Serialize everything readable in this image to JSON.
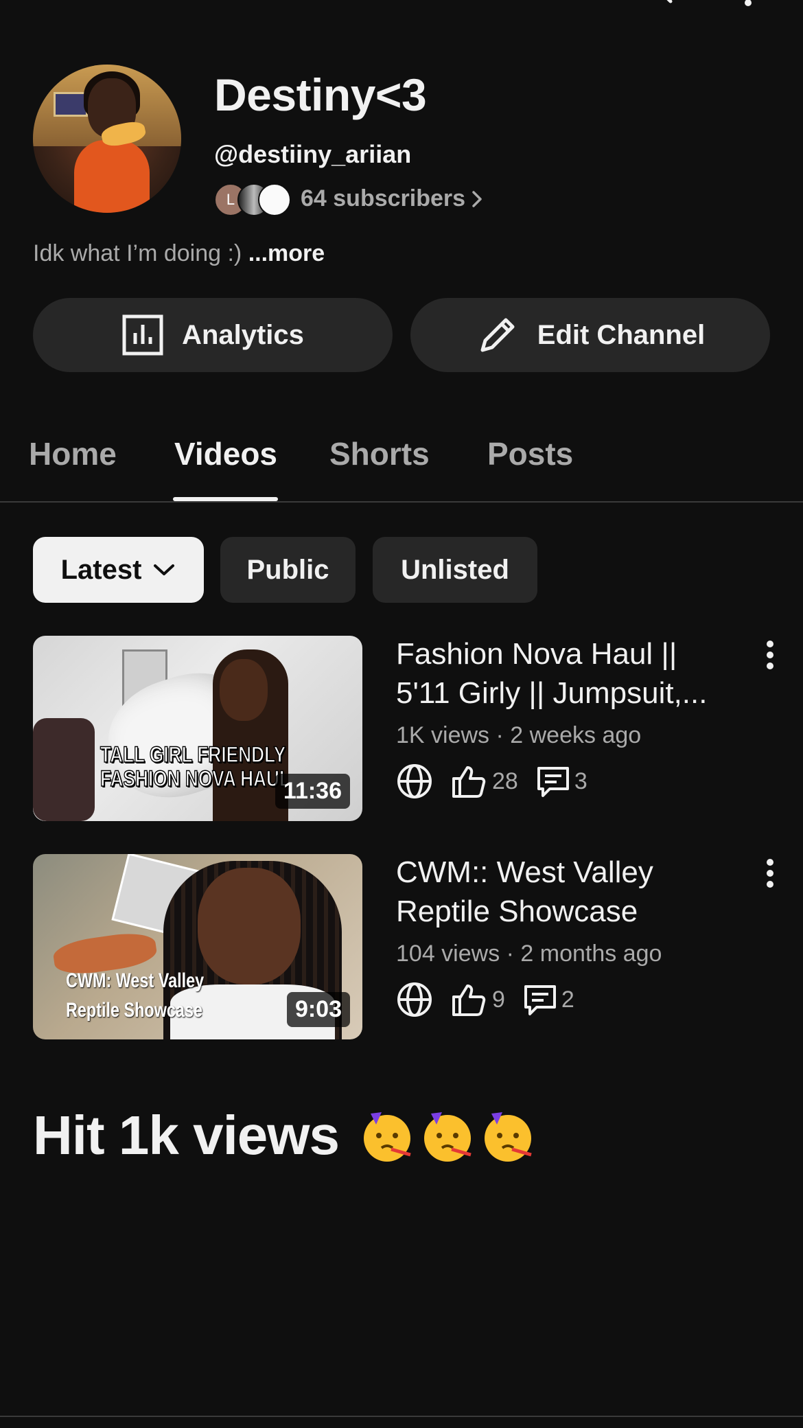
{
  "channel": {
    "name": "Destiny<3",
    "handle": "@destiiny_ariian",
    "subscribers": "64 subscribers",
    "subscriber_avatar_initial": "L",
    "bio": "Idk what I’m doing :)",
    "bio_more": "...more"
  },
  "actions": {
    "analytics_label": "Analytics",
    "edit_label": "Edit Channel"
  },
  "tabs": [
    {
      "label": "Home",
      "active": false
    },
    {
      "label": "Videos",
      "active": true
    },
    {
      "label": "Shorts",
      "active": false
    },
    {
      "label": "Posts",
      "active": false
    }
  ],
  "filters": [
    {
      "label": "Latest",
      "selected": true,
      "dropdown": true
    },
    {
      "label": "Public",
      "selected": false
    },
    {
      "label": "Unlisted",
      "selected": false
    }
  ],
  "videos": [
    {
      "title": "Fashion Nova Haul || 5'11 Girly || Jumpsuit,...",
      "meta": "1K views · 2 weeks ago",
      "duration": "11:36",
      "thumb_caption_line1": "TALL GIRL FRIENDLY",
      "thumb_caption_line2": "FASHION NOVA HAUL",
      "likes": "28",
      "comments": "3",
      "visibility_icon": "globe-icon"
    },
    {
      "title": "CWM:: West Valley Reptile Showcase",
      "meta": "104 views · 2 months ago",
      "duration": "9:03",
      "thumb_caption_line1": "CWM: West Valley",
      "thumb_caption_line2": "Reptile Showcase",
      "likes": "9",
      "comments": "2",
      "visibility_icon": "globe-icon"
    }
  ],
  "post": {
    "text": "Hit 1k views",
    "emoji": "partying-face",
    "emoji_count": 3
  },
  "colors": {
    "background": "#0f0f0f",
    "surface": "#272727",
    "text_primary": "#f1f1f1",
    "text_secondary": "#aaaaaa",
    "chip_selected_bg": "#f1f1f1"
  }
}
